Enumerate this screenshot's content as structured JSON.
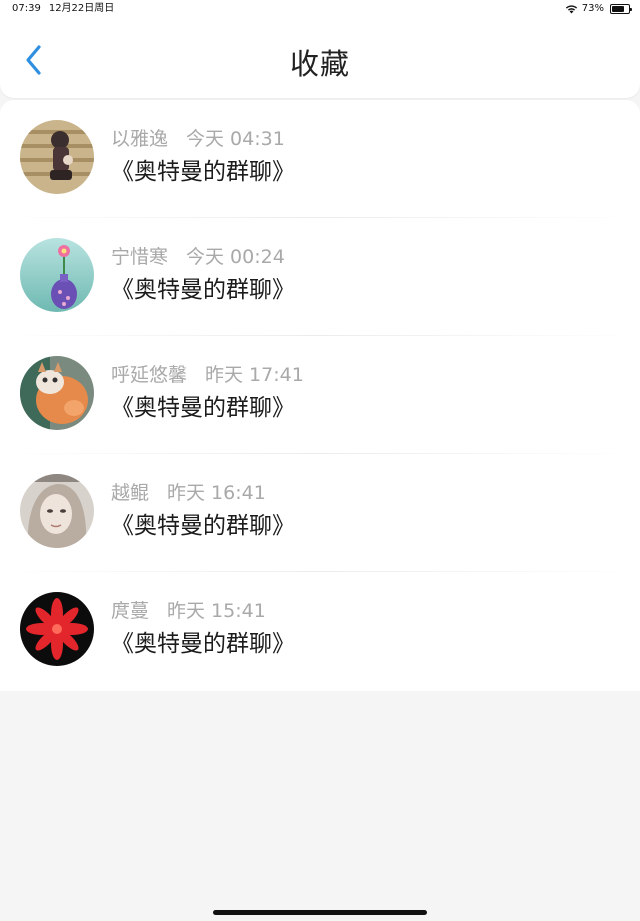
{
  "status_bar": {
    "time": "07:39",
    "date": "12月22日周日",
    "battery": "73%",
    "battery_level": 0.73
  },
  "nav": {
    "title": "收藏",
    "back_icon": "chevron-left-icon"
  },
  "items": [
    {
      "name": "以雅逸",
      "time": "今天 04:31",
      "title": "《奥特曼的群聊》",
      "avatar": "anime-girl-avatar"
    },
    {
      "name": "宁惜寒",
      "time": "今天 00:24",
      "title": "《奥特曼的群聊》",
      "avatar": "flower-vase-avatar"
    },
    {
      "name": "呼延悠馨",
      "time": "昨天 17:41",
      "title": "《奥特曼的群聊》",
      "avatar": "cat-avatar"
    },
    {
      "name": "越鲲",
      "time": "昨天 16:41",
      "title": "《奥特曼的群聊》",
      "avatar": "portrait-avatar"
    },
    {
      "name": "庹蔓",
      "time": "昨天 15:41",
      "title": "《奥特曼的群聊》",
      "avatar": "red-flower-avatar"
    }
  ],
  "colors": {
    "accent": "#2f8fe0",
    "background": "#f6f5f5",
    "secondary_text": "#a9a9a9"
  }
}
